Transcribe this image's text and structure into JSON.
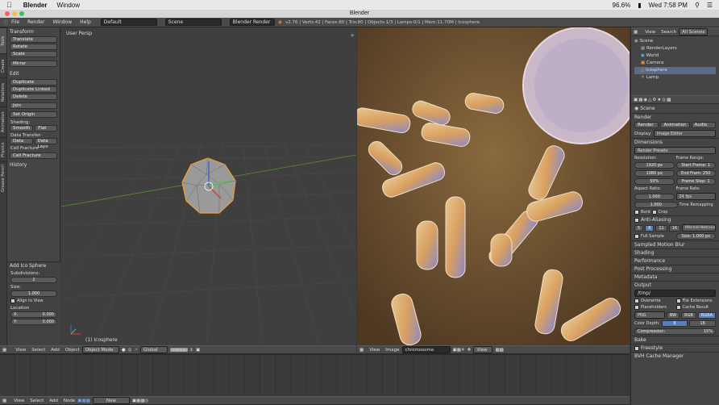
{
  "macbar": {
    "app": "Blender",
    "window_menu": "Window",
    "battery": "96.6%",
    "clock": "Wed 7:58 PM"
  },
  "titlebar": {
    "title": "Blender"
  },
  "infobar": {
    "menus": [
      "File",
      "Render",
      "Window",
      "Help"
    ],
    "layout": "Default",
    "scene": "Scene",
    "engine": "Blender Render",
    "stats": "v2.76 | Verts:42 | Faces:80 | Tris:80 | Objects:1/3 | Lamps:0/1 | Mem:11.70M | Icosphere"
  },
  "tabs": [
    "Tools",
    "Create",
    "Relations",
    "Animation",
    "Physics",
    "Grease Pencil"
  ],
  "tools": {
    "transform": "Transform",
    "translate": "Translate",
    "rotate": "Rotate",
    "scale": "Scale",
    "mirror": "Mirror",
    "edit": "Edit",
    "duplicate": "Duplicate",
    "duplicate_linked": "Duplicate Linked",
    "delete": "Delete",
    "join": "Join",
    "set_origin": "Set Origin",
    "shading": "Shading:",
    "smooth": "Smooth",
    "flat": "Flat",
    "data_transfer": "Data Transfer:",
    "data": "Data",
    "data_layout": "Data Layo",
    "cell_fracture1": "Cell Fracture",
    "cell_fracture2": "Cell Fracture",
    "history": "History"
  },
  "operator": {
    "title": "Add Ico Sphere",
    "subdivisions_label": "Subdivisions:",
    "subdivisions": "2",
    "size_label": "Size:",
    "size": "1.000",
    "align": "Align to View",
    "location_label": "Location",
    "x": "X:",
    "x_val": "0.000",
    "y": "Y:",
    "y_val": "0.000"
  },
  "viewport": {
    "label": "User Persp",
    "object_label": "(1) Icosphere"
  },
  "viewport_header": {
    "view": "View",
    "select": "Select",
    "add": "Add",
    "object": "Object",
    "mode": "Object Mode",
    "orientation": "Global"
  },
  "image_header": {
    "view": "View",
    "image": "Image",
    "image_name": "chromosome refere...",
    "view2": "View"
  },
  "outliner": {
    "view": "View",
    "search": "Search",
    "all_scenes": "All Scenes",
    "items": [
      "Scene",
      "RenderLayers",
      "World",
      "Camera",
      "Icosphere",
      "Lamp"
    ]
  },
  "properties": {
    "scene": "Scene",
    "render": "Render",
    "render_btn": "Render",
    "animation_btn": "Animation",
    "audio_btn": "Audio",
    "display_label": "Display:",
    "display_val": "Image Editor",
    "dimensions": "Dimensions",
    "render_presets": "Render Presets",
    "resolution": "Resolution:",
    "res_x": "1920 px",
    "res_y": "1080 px",
    "res_pct": "50%",
    "frame_range": "Frame Range:",
    "start": "Start Frame: 1",
    "end": "End Fram: 250",
    "step": "Frame Step: 1",
    "aspect": "Aspect Ratio:",
    "asp_x": "1.000",
    "asp_y": "1.000",
    "frame_rate": "Frame Rate:",
    "fps": "24 fps",
    "time_remap": "Time Remapping",
    "bord": "Bord",
    "crop": "Crop",
    "aa": "Anti-Aliasing",
    "aa_vals": [
      "5",
      "8",
      "11",
      "16"
    ],
    "filter": "Mitchell-Netraval",
    "full_sample": "Full Sample",
    "size": "Size: 1.000 px",
    "motion_blur": "Sampled Motion Blur",
    "shading": "Shading",
    "performance": "Performance",
    "post": "Post Processing",
    "metadata": "Metadata",
    "output": "Output",
    "output_path": "/tmp/",
    "overwrite": "Overwrite",
    "file_ext": "File Extensions",
    "placeholders": "Placeholders",
    "cache": "Cache Result",
    "format": "PNG",
    "bw": "BW",
    "rgb": "RGB",
    "rgba": "RGBA",
    "color_depth": "Color Depth:",
    "depth8": "8",
    "depth16": "16",
    "compression": "Compression:",
    "comp_val": "15%",
    "bake": "Bake",
    "freestyle": "Freestyle",
    "bvh": "BVH Cache Manager"
  },
  "timeline_header": {
    "view": "View",
    "select": "Select",
    "add": "Add",
    "node": "Node",
    "new": "New"
  }
}
